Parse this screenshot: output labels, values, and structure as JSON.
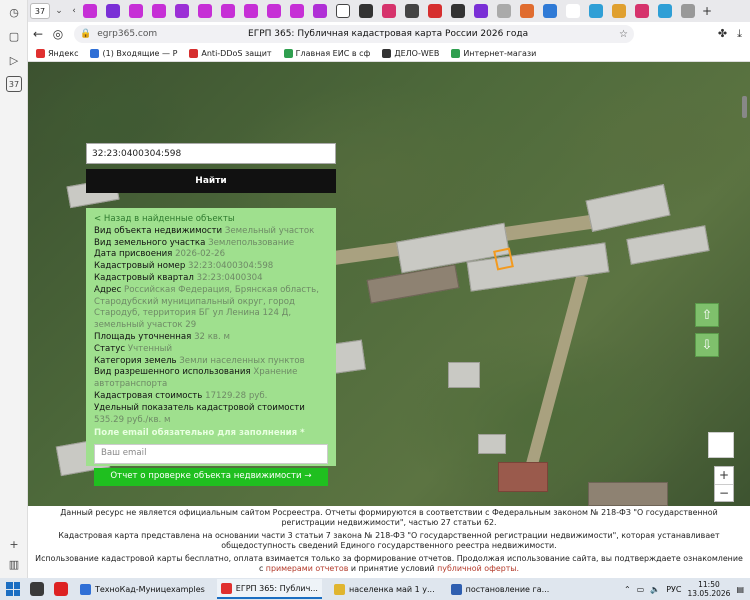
{
  "browser": {
    "tab_count": "37",
    "url_domain": "egrp365.com",
    "page_title": "ЕГРП 365: Публичная кадастровая карта России 2026 года",
    "tab_favicon_colors": [
      "#c62fd6",
      "#7a2fd6",
      "#c62fd6",
      "#c62fd6",
      "#9b2fd6",
      "#c62fd6",
      "#c62fd6",
      "#c62fd6",
      "#c62fd6",
      "#c62fd6",
      "#b02fd6",
      "#ffffff",
      "#333333",
      "#d6336c",
      "#444444",
      "#d62f2f",
      "#333333",
      "#7a2fd6",
      "#aaaaaa",
      "#e06c2f",
      "#2f7ad6",
      "#ffffff",
      "#2f9fd6",
      "#e0a02f",
      "#d6336c",
      "#2f9fd6",
      "#999999"
    ],
    "bookmarks": [
      {
        "label": "Яндекс",
        "color": "#e0302f"
      },
      {
        "label": "(1) Входящие — Р",
        "color": "#2f6fd6"
      },
      {
        "label": "Anti-DDoS защит",
        "color": "#d62f2f"
      },
      {
        "label": "Главная ЕИС в сф",
        "color": "#2f9f4f"
      },
      {
        "label": "ДЕЛО-WEB",
        "color": "#333333"
      },
      {
        "label": "Интернет-магази",
        "color": "#2f9f4f"
      }
    ]
  },
  "search": {
    "value": "32:23:0400304:598",
    "button_label": "Найти"
  },
  "info": {
    "back_link": "< Назад в найденные объекты",
    "rows": [
      {
        "label": "Вид объекта недвижимости",
        "value": "Земельный участок"
      },
      {
        "label": "Вид земельного участка",
        "value": "Землепользование"
      },
      {
        "label": "Дата присвоения",
        "value": "2026-02-26"
      },
      {
        "label": "Кадастровый номер",
        "value": "32:23:0400304:598"
      },
      {
        "label": "Кадастровый квартал",
        "value": "32:23:0400304"
      },
      {
        "label": "Адрес",
        "value": "Российская Федерация, Брянская область, Стародубский муниципальный округ, город Стародуб, территория БГ ул Ленина 124 Д, земельный участок 29"
      },
      {
        "label": "Площадь уточненная",
        "value": "32 кв. м"
      },
      {
        "label": "Статус",
        "value": "Учтенный"
      },
      {
        "label": "Категория земель",
        "value": "Земли населенных пунктов"
      },
      {
        "label": "Вид разрешенного использования",
        "value": "Хранение автотранспорта"
      },
      {
        "label": "Кадастровая стоимость",
        "value": "17129.28 руб."
      },
      {
        "label": "Удельный показатель кадастровой стоимости",
        "value": "535.29 руб./кв. м"
      }
    ],
    "email_required": "Поле email обязательно для заполнения *",
    "email_placeholder": "Ваш email",
    "report_button": "Отчет о проверке объекта недвижимости →"
  },
  "map_controls": {
    "up": "⇧",
    "down": "⇩",
    "zoom_in": "+",
    "zoom_out": "−"
  },
  "footer": {
    "line1": "Данный ресурс не является официальным сайтом Росреестра. Отчеты формируются в соответствии с Федеральным законом № 218-ФЗ \"О государственной регистрации недвижимости\", частью 27 статьи 62.",
    "line2": "Кадастровая карта представлена на основании части 3 статьи 7 закона № 218-ФЗ \"О государственной регистрации недвижимости\", которая устанавливает общедоступность сведений Единого государственного реестра недвижимости.",
    "line3_pre": "Использование кадастровой карты бесплатно, оплата взимается только за формирование отчетов. Продолжая использование сайта, вы подтверждаете ознакомление с",
    "line3_link1": "примерами отчетов",
    "line3_mid": "и принятие условий",
    "line3_link2": "публичной оферты."
  },
  "taskbar": {
    "tasks": [
      {
        "label": "ТехноКад-Муницexamples",
        "color": "#2f6fd6"
      },
      {
        "label": "ЕГРП 365: Публич...",
        "color": "#e0302f"
      },
      {
        "label": "населенка май 1 у...",
        "color": "#e0b52f"
      },
      {
        "label": "постановление га...",
        "color": "#2f5fb0"
      }
    ],
    "lang": "РУС",
    "time": "11:50",
    "date": "13.05.2026"
  }
}
